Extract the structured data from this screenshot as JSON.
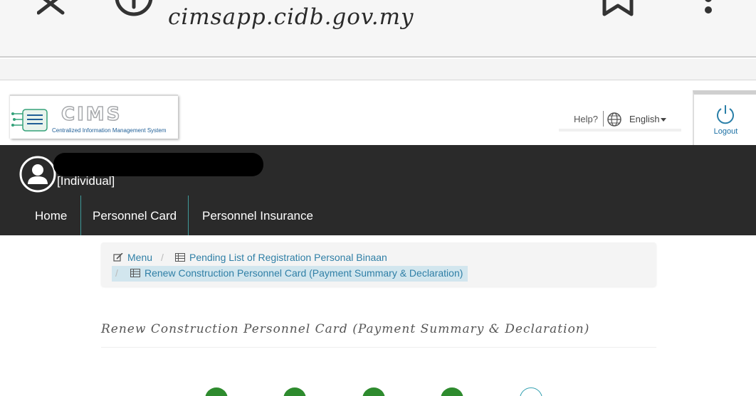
{
  "browser": {
    "url": "cimsapp.cidb.gov.my",
    "icons": [
      "close-icon",
      "info-icon",
      "bookmark-icon",
      "more-vert-icon"
    ]
  },
  "header": {
    "logo_text": "CIMS",
    "logo_tagline": "Centralized Information Management System",
    "help_label": "Help?",
    "language_label": "English",
    "logout_label": "Logout"
  },
  "user": {
    "role": "[Individual]"
  },
  "nav": {
    "tabs": [
      {
        "label": "Home",
        "active": false
      },
      {
        "label": "Personnel Card",
        "active": true
      },
      {
        "label": "Personnel Insurance",
        "active": false
      }
    ]
  },
  "breadcrumb": {
    "items": [
      {
        "label": "Menu",
        "icon": "edit-icon"
      },
      {
        "label": "Pending List of Registration Personal Binaan",
        "icon": "table-icon"
      },
      {
        "label": "Renew Construction Personnel Card (Payment Summary & Declaration)",
        "icon": "table-icon",
        "current": true
      }
    ],
    "separator": "/"
  },
  "page": {
    "heading": "Renew Construction Personnel Card (Payment Summary & Declaration)"
  },
  "stepper": {
    "steps": [
      {
        "status": "done"
      },
      {
        "status": "done"
      },
      {
        "status": "done"
      },
      {
        "status": "done"
      },
      {
        "status": "current"
      }
    ]
  },
  "colors": {
    "nav_background": "#2a2a2a",
    "link": "#2f7fa6",
    "step_done": "#2e8b2e",
    "step_current_border": "#3aa3b3",
    "logo_tagline": "#1f5e96"
  }
}
